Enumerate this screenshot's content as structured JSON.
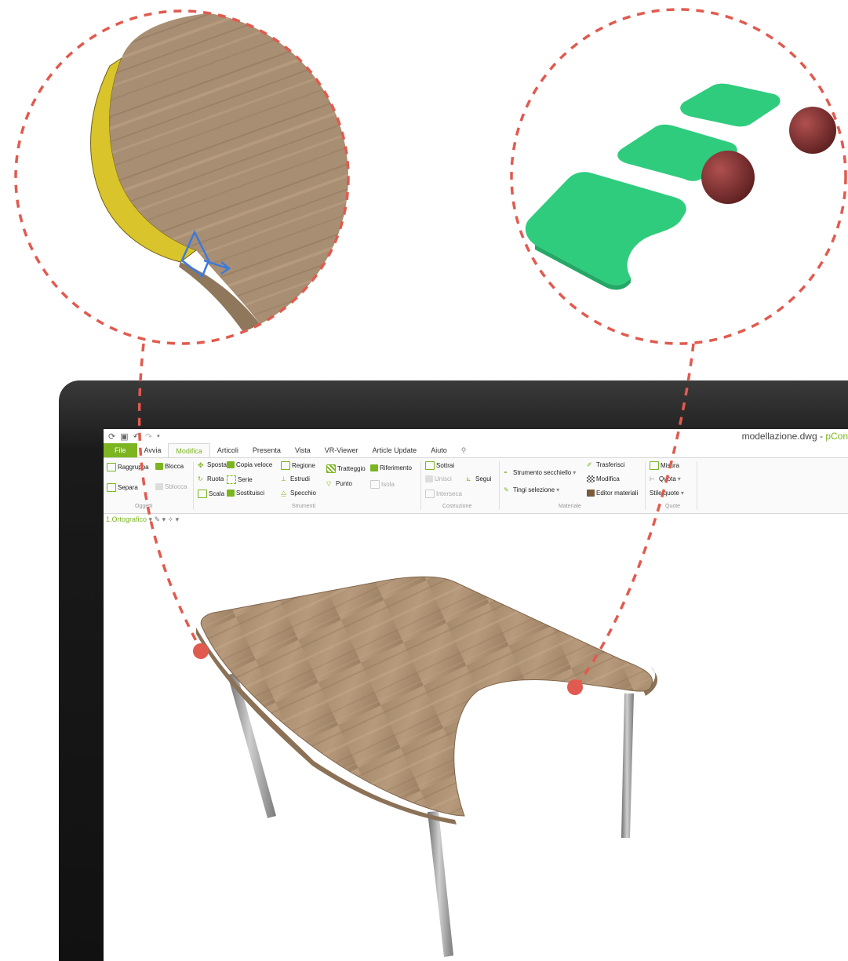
{
  "window": {
    "document_title": "modellazione.dwg",
    "separator": " - ",
    "app_name": "pCon"
  },
  "tabs": [
    {
      "label": "File"
    },
    {
      "label": "Avvia"
    },
    {
      "label": "Modifica",
      "active": true
    },
    {
      "label": "Articoli"
    },
    {
      "label": "Presenta"
    },
    {
      "label": "Vista"
    },
    {
      "label": "VR-Viewer"
    },
    {
      "label": "Article Update"
    },
    {
      "label": "Aiuto"
    }
  ],
  "ribbon": {
    "oggetti": {
      "raggruppa": "Raggruppa",
      "blocca": "Blocca",
      "separa": "Separa",
      "sblocca": "Sblocca",
      "group_label": "Oggetti"
    },
    "strumenti": {
      "sposta": "Sposta",
      "copia_veloce": "Copia veloce",
      "regione": "Regione",
      "ruota": "Ruota",
      "serie": "Serie",
      "estrudi": "Estrudi",
      "scala": "Scala",
      "sostituisci": "Sostituisci",
      "specchio": "Specchio",
      "tratteggio": "Tratteggio",
      "riferimento": "Riferimento",
      "punto": "Punto",
      "isola": "Isola",
      "group_label": "Strumenti"
    },
    "costruzione": {
      "sottrai": "Sottrai",
      "unisci": "Unisci",
      "segui": "Segui",
      "interseca": "Interseca",
      "group_label": "Costruzione"
    },
    "materiale": {
      "strumento_secchiello": "Strumento secchiello",
      "tingi_selezione": "Tingi selezione",
      "trasferisci": "Trasferisci",
      "modifica": "Modifica",
      "editor_materiali": "Editor materiali",
      "group_label": "Materiale"
    },
    "quote": {
      "misura": "Misura",
      "quota": "Quota",
      "stile_quote": "Stile quote",
      "group_label": "Quote"
    }
  },
  "viewport": {
    "view_name": "1.Ortografico"
  },
  "colors": {
    "accent": "#7cb520",
    "callout_dash": "#e15a4f",
    "wood": "#a98d6f",
    "edge_band": "#d8c22a",
    "shape_green": "#2fcc7e",
    "sphere": "#8a3535"
  }
}
